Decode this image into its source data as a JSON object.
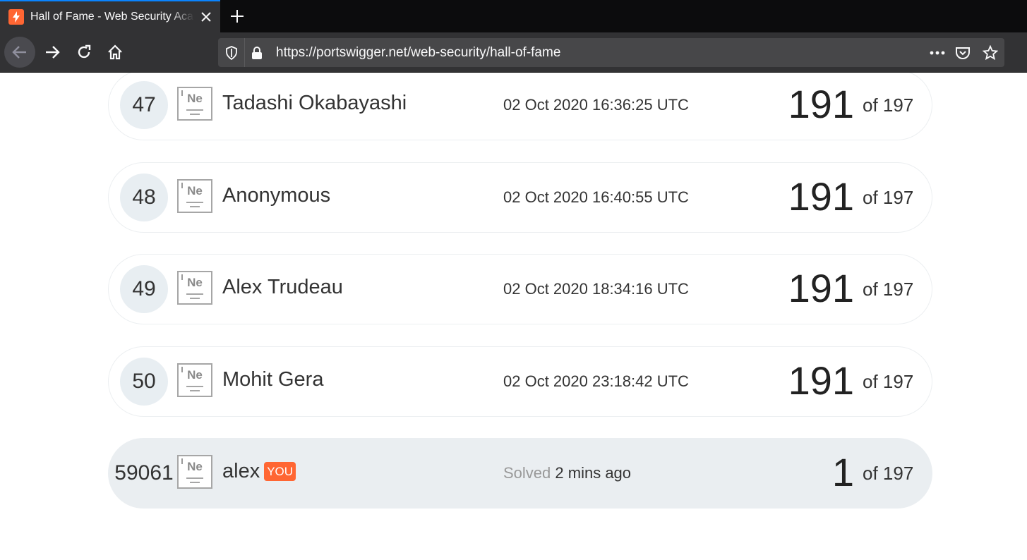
{
  "browser": {
    "tab_title": "Hall of Fame - Web Security Academy",
    "url": "https://portswigger.net/web-security/hall-of-fame",
    "accent_color": "#0a84ff"
  },
  "leaderboard": {
    "rows": [
      {
        "rank": "47",
        "name": "Tadashi Okabayashi",
        "date": "02 Oct 2020 16:36:25 UTC",
        "score": "191",
        "total": "of 197"
      },
      {
        "rank": "48",
        "name": "Anonymous",
        "date": "02 Oct 2020 16:40:55 UTC",
        "score": "191",
        "total": "of 197"
      },
      {
        "rank": "49",
        "name": "Alex Trudeau",
        "date": "02 Oct 2020 18:34:16 UTC",
        "score": "191",
        "total": "of 197"
      },
      {
        "rank": "50",
        "name": "Mohit Gera",
        "date": "02 Oct 2020 23:18:42 UTC",
        "score": "191",
        "total": "of 197"
      }
    ],
    "badge_symbol": "Ne",
    "you_row": {
      "rank": "59061",
      "name": "alex",
      "you_label": "YOU",
      "solved_prefix": "Solved",
      "solved_time": "2 mins ago",
      "score": "1",
      "total": "of 197"
    },
    "highlight_color": "#ff6633"
  }
}
